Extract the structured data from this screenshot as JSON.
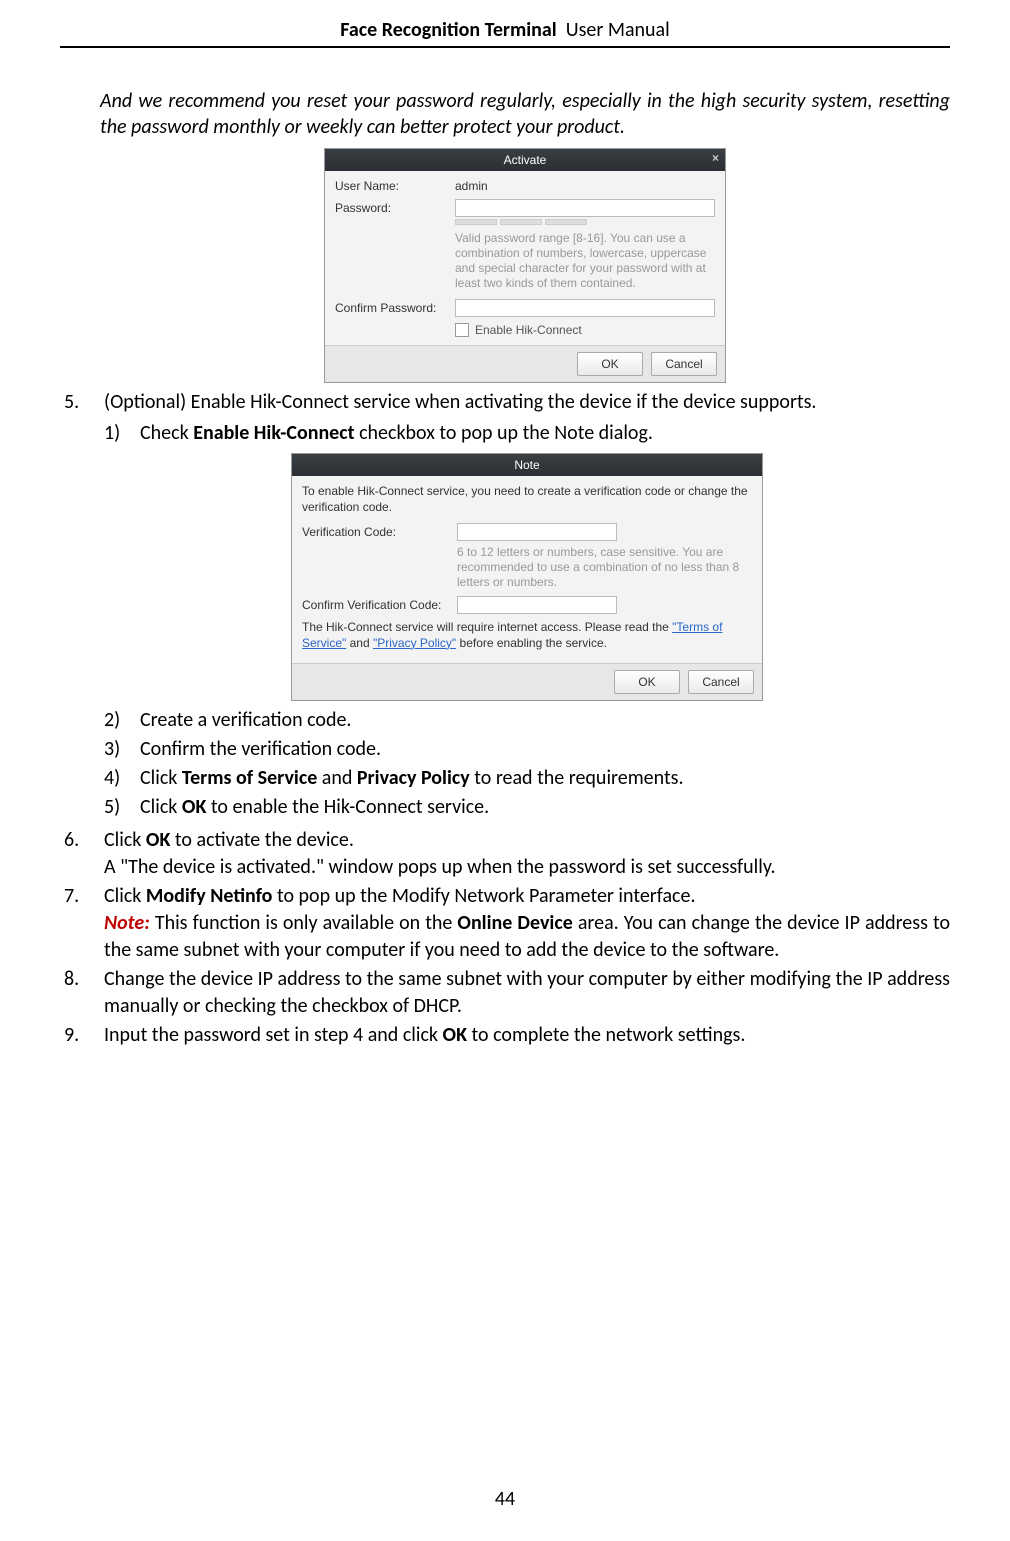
{
  "header": {
    "bold": "Face Recognition Terminal",
    "normal": "User Manual"
  },
  "page_number": "44",
  "intro": "And we recommend you reset your password regularly, especially in the high security system, resetting the password monthly or weekly can better protect your product.",
  "activate_dialog": {
    "title": "Activate",
    "fields": {
      "user_name_label": "User Name:",
      "user_name_value": "admin",
      "password_label": "Password:",
      "hint": "Valid password range [8-16]. You can use a combination of numbers, lowercase, uppercase and special character for your password with at least two kinds of them contained.",
      "confirm_label": "Confirm Password:",
      "enable_hik": "Enable Hik-Connect"
    },
    "buttons": {
      "ok": "OK",
      "cancel": "Cancel"
    }
  },
  "note_dialog": {
    "title": "Note",
    "intro": "To enable Hik-Connect service, you need to create a verification code or change the verification code.",
    "vcode_label": "Verification Code:",
    "vcode_hint": "6 to 12 letters or numbers, case sensitive. You are recommended to use a combination of no less than 8 letters or numbers.",
    "confirm_vcode_label": "Confirm Verification Code:",
    "access_pre": "The Hik-Connect service will require internet access. Please read the ",
    "terms_link": "\"Terms of Service\"",
    "access_mid": " and ",
    "privacy_link": "\"Privacy Policy\"",
    "access_post": " before enabling the service.",
    "buttons": {
      "ok": "OK",
      "cancel": "Cancel"
    }
  },
  "list": {
    "item5": {
      "num": "5.",
      "text": "(Optional) Enable Hik-Connect service when activating the device if the device supports.",
      "sub1": {
        "num": "1)",
        "pre": "Check ",
        "bold": "Enable Hik-Connect",
        "post": " checkbox to pop up the Note dialog."
      },
      "sub2": {
        "num": "2)",
        "text": "Create a verification code."
      },
      "sub3": {
        "num": "3)",
        "text": "Confirm the verification code."
      },
      "sub4": {
        "num": "4)",
        "pre": "Click ",
        "b1": "Terms of Service",
        "mid": " and ",
        "b2": "Privacy Policy",
        "post": " to read the requirements."
      },
      "sub5": {
        "num": "5)",
        "pre": "Click ",
        "b1": "OK",
        "post": " to enable the Hik-Connect service."
      }
    },
    "item6": {
      "num": "6.",
      "pre": "Click ",
      "b1": "OK",
      "post": " to activate the device.",
      "line2": "A \"The device is activated.\" window pops up when the password is set successfully."
    },
    "item7": {
      "num": "7.",
      "pre": "Click ",
      "b1": "Modify Netinfo",
      "post": " to pop up the Modify Network Parameter interface.",
      "note_label": "Note:",
      "note_pre": " This function is only available on the ",
      "note_bold": "Online Device",
      "note_post": " area. You can change the device IP address to the same subnet with your computer if you need to add the device to the software."
    },
    "item8": {
      "num": "8.",
      "text": "Change the device IP address to the same subnet with your computer by either modifying the IP address manually or checking the checkbox of DHCP."
    },
    "item9": {
      "num": "9.",
      "pre": "Input the password set in step 4 and click ",
      "b1": "OK",
      "post": " to complete the network settings."
    }
  }
}
